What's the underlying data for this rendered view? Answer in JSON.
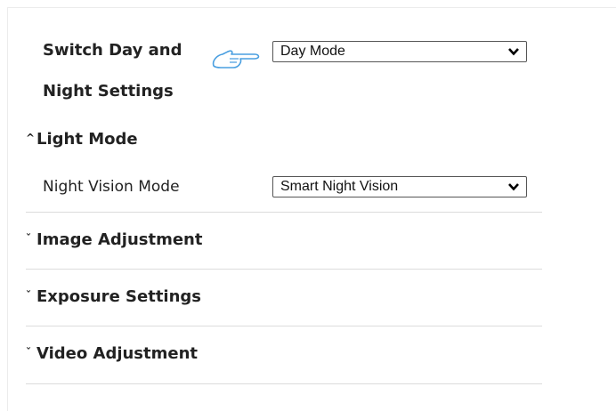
{
  "switch_day_night": {
    "label_line1": "Switch Day and",
    "label_line2": "Night Settings",
    "select_value": "Day Mode",
    "pointer_icon": "hand-pointer-icon"
  },
  "sections": {
    "light_mode": {
      "caret": "^",
      "title": "Light Mode",
      "expanded": true
    },
    "image_adjustment": {
      "caret": "ˇ",
      "title": "Image Adjustment",
      "expanded": false
    },
    "exposure_settings": {
      "caret": "ˇ",
      "title": "Exposure Settings",
      "expanded": false
    },
    "video_adjustment": {
      "caret": "ˇ",
      "title": "Video Adjustment",
      "expanded": false
    }
  },
  "light_mode_fields": {
    "night_vision_label": "Night Vision Mode",
    "night_vision_value": "Smart Night Vision"
  }
}
